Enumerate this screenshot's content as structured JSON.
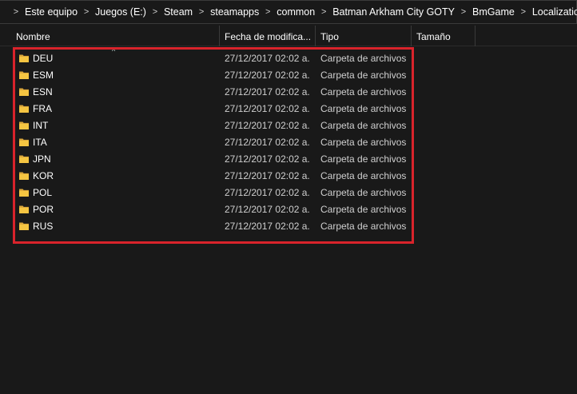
{
  "address_bar": {
    "crumbs": [
      "Este equipo",
      "Juegos (E:)",
      "Steam",
      "steamapps",
      "common",
      "Batman Arkham City GOTY",
      "BmGame",
      "Localization"
    ],
    "separator": ">"
  },
  "columns": {
    "name": "Nombre",
    "date": "Fecha de modifica...",
    "type": "Tipo",
    "size": "Tamaño",
    "sort_indicator": "^"
  },
  "rows": [
    {
      "name": "DEU",
      "date": "27/12/2017 02:02 a...",
      "type": "Carpeta de archivos"
    },
    {
      "name": "ESM",
      "date": "27/12/2017 02:02 a...",
      "type": "Carpeta de archivos"
    },
    {
      "name": "ESN",
      "date": "27/12/2017 02:02 a...",
      "type": "Carpeta de archivos"
    },
    {
      "name": "FRA",
      "date": "27/12/2017 02:02 a...",
      "type": "Carpeta de archivos"
    },
    {
      "name": "INT",
      "date": "27/12/2017 02:02 a...",
      "type": "Carpeta de archivos"
    },
    {
      "name": "ITA",
      "date": "27/12/2017 02:02 a...",
      "type": "Carpeta de archivos"
    },
    {
      "name": "JPN",
      "date": "27/12/2017 02:02 a...",
      "type": "Carpeta de archivos"
    },
    {
      "name": "KOR",
      "date": "27/12/2017 02:02 a...",
      "type": "Carpeta de archivos"
    },
    {
      "name": "POL",
      "date": "27/12/2017 02:02 a...",
      "type": "Carpeta de archivos"
    },
    {
      "name": "POR",
      "date": "27/12/2017 02:02 a...",
      "type": "Carpeta de archivos"
    },
    {
      "name": "RUS",
      "date": "27/12/2017 02:02 a...",
      "type": "Carpeta de archivos"
    }
  ],
  "colors": {
    "background": "#191919",
    "folder": "#f5c542",
    "highlight": "#d9232b"
  },
  "icons": {
    "address": "folder-icon",
    "row": "folder-icon"
  }
}
